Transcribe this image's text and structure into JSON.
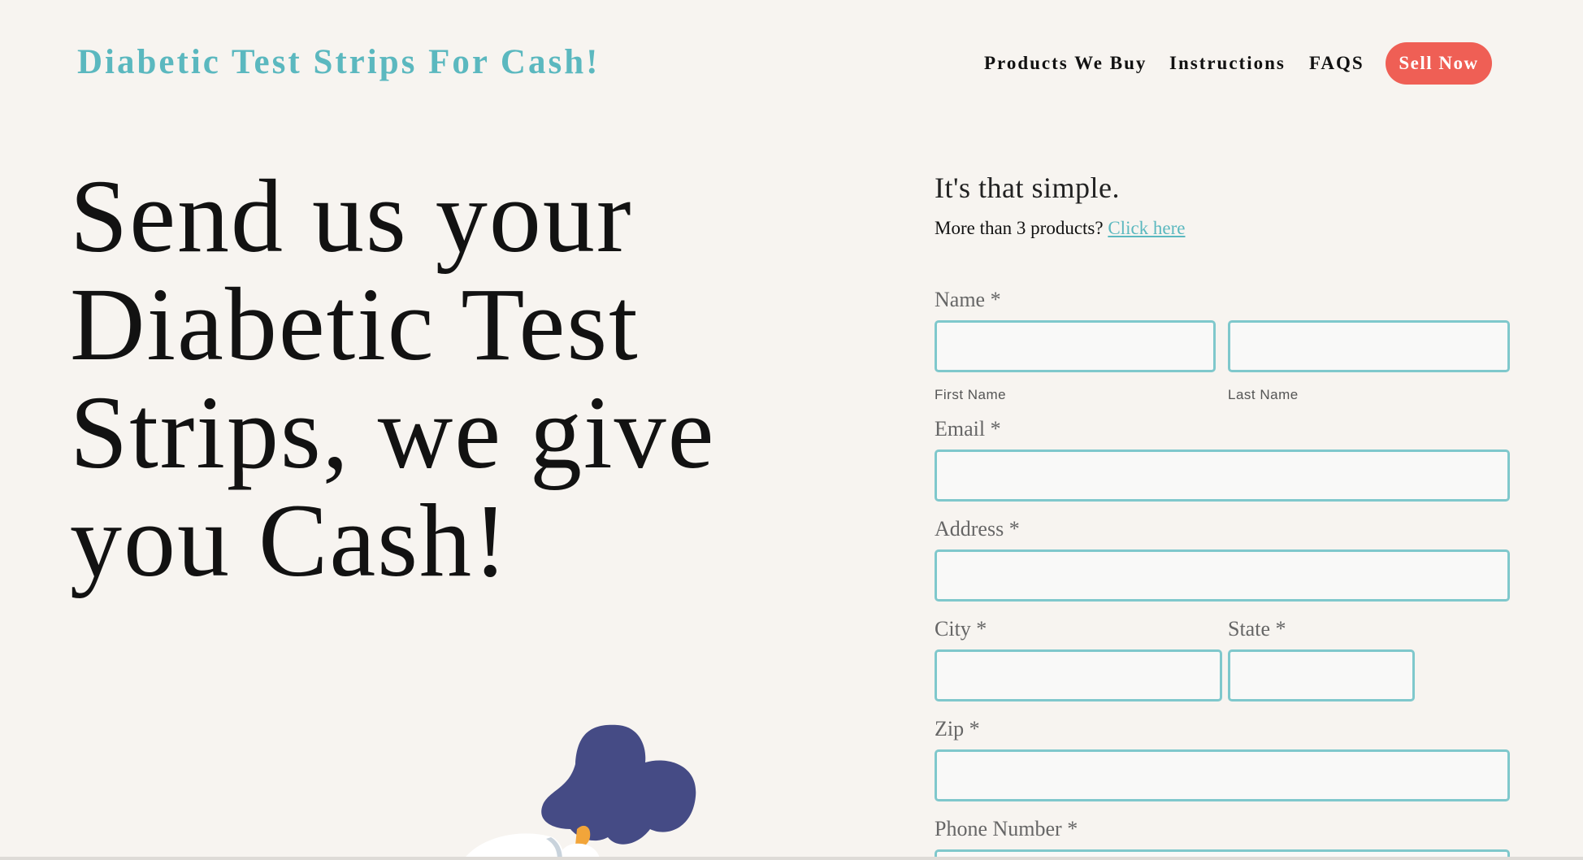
{
  "header": {
    "site_title": "Diabetic Test Strips For Cash!",
    "nav": {
      "products": "Products We Buy",
      "instructions": "Instructions",
      "faqs": "FAQS",
      "sell_now": "Sell Now"
    }
  },
  "hero": {
    "headline_lines": [
      "Send us your",
      "Diabetic Test",
      "Strips, we give",
      "you Cash!"
    ]
  },
  "form": {
    "intro": "It's that simple.",
    "more_prefix": "More than 3 products?",
    "more_link": "Click here",
    "name_label": "Name *",
    "first_name_sub": "First Name",
    "last_name_sub": "Last Name",
    "email_label": "Email *",
    "address_label": "Address *",
    "city_label": "City *",
    "state_label": "State *",
    "zip_label": "Zip *",
    "phone_label": "Phone Number *",
    "values": {
      "first_name": "",
      "last_name": "",
      "email": "",
      "address": "",
      "city": "",
      "state": "",
      "zip": "",
      "phone": ""
    }
  },
  "colors": {
    "brand_teal": "#5bb8bf",
    "button_red": "#ef5f55",
    "background": "#f7f4f0",
    "input_border": "#7fc8cc",
    "illustration_hair": "#454b85"
  }
}
